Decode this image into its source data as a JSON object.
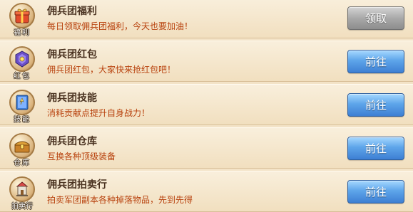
{
  "items": [
    {
      "title": "佣兵团福利",
      "desc": "每日领取佣兵团福利，今天也要加油！",
      "icon_label": "福利",
      "icon": "gift-icon",
      "button": "领取",
      "button_style": "gray"
    },
    {
      "title": "佣兵团红包",
      "desc": "佣兵团红包，大家快来抢红包吧！",
      "icon_label": "红包",
      "icon": "red-envelope-icon",
      "button": "前往",
      "button_style": "blue"
    },
    {
      "title": "佣兵团技能",
      "desc": "消耗贡献点提升自身战力！",
      "icon_label": "技能",
      "icon": "skill-book-icon",
      "button": "前往",
      "button_style": "blue"
    },
    {
      "title": "佣兵团仓库",
      "desc": "互换各种顶级装备",
      "icon_label": "仓库",
      "icon": "treasure-chest-icon",
      "button": "前往",
      "button_style": "blue"
    },
    {
      "title": "佣兵团拍卖行",
      "desc": "拍卖军团副本各种掉落物品，先到先得",
      "icon_label": "拍卖行",
      "icon": "auction-house-icon",
      "button": "前往",
      "button_style": "blue"
    }
  ],
  "colors": {
    "title": "#4a3220",
    "desc": "#b8420e",
    "row_bg": "#f3e3c7",
    "button_blue": "#4e93e0",
    "button_gray": "#9e9e9e"
  }
}
